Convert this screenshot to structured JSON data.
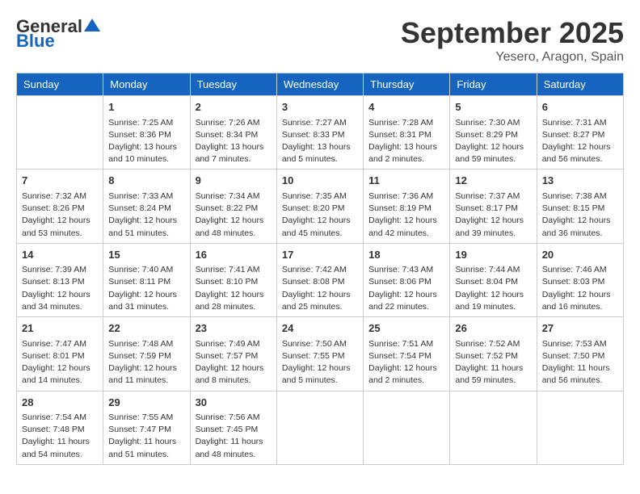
{
  "logo": {
    "general": "General",
    "blue": "Blue"
  },
  "header": {
    "month": "September 2025",
    "location": "Yesero, Aragon, Spain"
  },
  "weekdays": [
    "Sunday",
    "Monday",
    "Tuesday",
    "Wednesday",
    "Thursday",
    "Friday",
    "Saturday"
  ],
  "weeks": [
    [
      {
        "day": null
      },
      {
        "day": "1",
        "sunrise": "Sunrise: 7:25 AM",
        "sunset": "Sunset: 8:36 PM",
        "daylight": "Daylight: 13 hours and 10 minutes."
      },
      {
        "day": "2",
        "sunrise": "Sunrise: 7:26 AM",
        "sunset": "Sunset: 8:34 PM",
        "daylight": "Daylight: 13 hours and 7 minutes."
      },
      {
        "day": "3",
        "sunrise": "Sunrise: 7:27 AM",
        "sunset": "Sunset: 8:33 PM",
        "daylight": "Daylight: 13 hours and 5 minutes."
      },
      {
        "day": "4",
        "sunrise": "Sunrise: 7:28 AM",
        "sunset": "Sunset: 8:31 PM",
        "daylight": "Daylight: 13 hours and 2 minutes."
      },
      {
        "day": "5",
        "sunrise": "Sunrise: 7:30 AM",
        "sunset": "Sunset: 8:29 PM",
        "daylight": "Daylight: 12 hours and 59 minutes."
      },
      {
        "day": "6",
        "sunrise": "Sunrise: 7:31 AM",
        "sunset": "Sunset: 8:27 PM",
        "daylight": "Daylight: 12 hours and 56 minutes."
      }
    ],
    [
      {
        "day": "7",
        "sunrise": "Sunrise: 7:32 AM",
        "sunset": "Sunset: 8:26 PM",
        "daylight": "Daylight: 12 hours and 53 minutes."
      },
      {
        "day": "8",
        "sunrise": "Sunrise: 7:33 AM",
        "sunset": "Sunset: 8:24 PM",
        "daylight": "Daylight: 12 hours and 51 minutes."
      },
      {
        "day": "9",
        "sunrise": "Sunrise: 7:34 AM",
        "sunset": "Sunset: 8:22 PM",
        "daylight": "Daylight: 12 hours and 48 minutes."
      },
      {
        "day": "10",
        "sunrise": "Sunrise: 7:35 AM",
        "sunset": "Sunset: 8:20 PM",
        "daylight": "Daylight: 12 hours and 45 minutes."
      },
      {
        "day": "11",
        "sunrise": "Sunrise: 7:36 AM",
        "sunset": "Sunset: 8:19 PM",
        "daylight": "Daylight: 12 hours and 42 minutes."
      },
      {
        "day": "12",
        "sunrise": "Sunrise: 7:37 AM",
        "sunset": "Sunset: 8:17 PM",
        "daylight": "Daylight: 12 hours and 39 minutes."
      },
      {
        "day": "13",
        "sunrise": "Sunrise: 7:38 AM",
        "sunset": "Sunset: 8:15 PM",
        "daylight": "Daylight: 12 hours and 36 minutes."
      }
    ],
    [
      {
        "day": "14",
        "sunrise": "Sunrise: 7:39 AM",
        "sunset": "Sunset: 8:13 PM",
        "daylight": "Daylight: 12 hours and 34 minutes."
      },
      {
        "day": "15",
        "sunrise": "Sunrise: 7:40 AM",
        "sunset": "Sunset: 8:11 PM",
        "daylight": "Daylight: 12 hours and 31 minutes."
      },
      {
        "day": "16",
        "sunrise": "Sunrise: 7:41 AM",
        "sunset": "Sunset: 8:10 PM",
        "daylight": "Daylight: 12 hours and 28 minutes."
      },
      {
        "day": "17",
        "sunrise": "Sunrise: 7:42 AM",
        "sunset": "Sunset: 8:08 PM",
        "daylight": "Daylight: 12 hours and 25 minutes."
      },
      {
        "day": "18",
        "sunrise": "Sunrise: 7:43 AM",
        "sunset": "Sunset: 8:06 PM",
        "daylight": "Daylight: 12 hours and 22 minutes."
      },
      {
        "day": "19",
        "sunrise": "Sunrise: 7:44 AM",
        "sunset": "Sunset: 8:04 PM",
        "daylight": "Daylight: 12 hours and 19 minutes."
      },
      {
        "day": "20",
        "sunrise": "Sunrise: 7:46 AM",
        "sunset": "Sunset: 8:03 PM",
        "daylight": "Daylight: 12 hours and 16 minutes."
      }
    ],
    [
      {
        "day": "21",
        "sunrise": "Sunrise: 7:47 AM",
        "sunset": "Sunset: 8:01 PM",
        "daylight": "Daylight: 12 hours and 14 minutes."
      },
      {
        "day": "22",
        "sunrise": "Sunrise: 7:48 AM",
        "sunset": "Sunset: 7:59 PM",
        "daylight": "Daylight: 12 hours and 11 minutes."
      },
      {
        "day": "23",
        "sunrise": "Sunrise: 7:49 AM",
        "sunset": "Sunset: 7:57 PM",
        "daylight": "Daylight: 12 hours and 8 minutes."
      },
      {
        "day": "24",
        "sunrise": "Sunrise: 7:50 AM",
        "sunset": "Sunset: 7:55 PM",
        "daylight": "Daylight: 12 hours and 5 minutes."
      },
      {
        "day": "25",
        "sunrise": "Sunrise: 7:51 AM",
        "sunset": "Sunset: 7:54 PM",
        "daylight": "Daylight: 12 hours and 2 minutes."
      },
      {
        "day": "26",
        "sunrise": "Sunrise: 7:52 AM",
        "sunset": "Sunset: 7:52 PM",
        "daylight": "Daylight: 11 hours and 59 minutes."
      },
      {
        "day": "27",
        "sunrise": "Sunrise: 7:53 AM",
        "sunset": "Sunset: 7:50 PM",
        "daylight": "Daylight: 11 hours and 56 minutes."
      }
    ],
    [
      {
        "day": "28",
        "sunrise": "Sunrise: 7:54 AM",
        "sunset": "Sunset: 7:48 PM",
        "daylight": "Daylight: 11 hours and 54 minutes."
      },
      {
        "day": "29",
        "sunrise": "Sunrise: 7:55 AM",
        "sunset": "Sunset: 7:47 PM",
        "daylight": "Daylight: 11 hours and 51 minutes."
      },
      {
        "day": "30",
        "sunrise": "Sunrise: 7:56 AM",
        "sunset": "Sunset: 7:45 PM",
        "daylight": "Daylight: 11 hours and 48 minutes."
      },
      {
        "day": null
      },
      {
        "day": null
      },
      {
        "day": null
      },
      {
        "day": null
      }
    ]
  ]
}
